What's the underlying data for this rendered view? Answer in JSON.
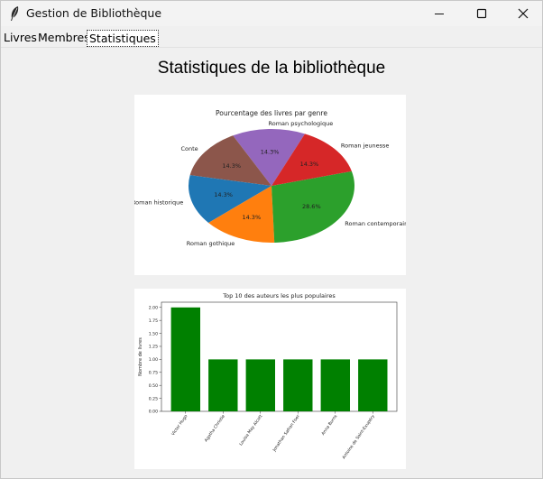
{
  "window": {
    "title": "Gestion de Bibliothèque",
    "minimize_icon": "minimize-icon",
    "maximize_icon": "maximize-icon",
    "close_icon": "close-icon",
    "app_icon": "feather-icon"
  },
  "menu": {
    "tabs": [
      {
        "label": "Livres"
      },
      {
        "label": "Membres"
      },
      {
        "label": "Statistiques",
        "selected": true
      }
    ]
  },
  "page": {
    "title": "Statistiques de la bibliothèque"
  },
  "chart_data": [
    {
      "type": "pie",
      "title": "Pourcentage des livres par genre",
      "slices": [
        {
          "label": "Roman psychologique",
          "value": 14.3,
          "pct_label": "14.3%",
          "color": "#9467bd"
        },
        {
          "label": "Conte",
          "value": 14.3,
          "pct_label": "14.3%",
          "color": "#8c564b"
        },
        {
          "label": "Roman historique",
          "value": 14.3,
          "pct_label": "14.3%",
          "color": "#1f77b4"
        },
        {
          "label": "Roman gothique",
          "value": 14.3,
          "pct_label": "14.3%",
          "color": "#ff7f0e"
        },
        {
          "label": "Roman contemporain",
          "value": 28.6,
          "pct_label": "28.6%",
          "color": "#2ca02c"
        },
        {
          "label": "Roman jeunesse",
          "value": 14.3,
          "pct_label": "14.3%",
          "color": "#d62728"
        }
      ]
    },
    {
      "type": "bar",
      "title": "Top 10 des auteurs les plus populaires",
      "xlabel": "",
      "ylabel": "Nombre de livres",
      "categories": [
        "Victor Hugo",
        "Agatha Christie",
        "Louisa May Alcott",
        "Jonathan Safran Foer",
        "Anna Burns",
        "Antoine de Saint-Exupéry"
      ],
      "values": [
        2,
        1,
        1,
        1,
        1,
        1
      ],
      "ylim": [
        0,
        2.1
      ],
      "yticks": [
        "0.00",
        "0.25",
        "0.50",
        "0.75",
        "1.00",
        "1.25",
        "1.50",
        "1.75",
        "2.00"
      ],
      "color": "#008000"
    }
  ]
}
